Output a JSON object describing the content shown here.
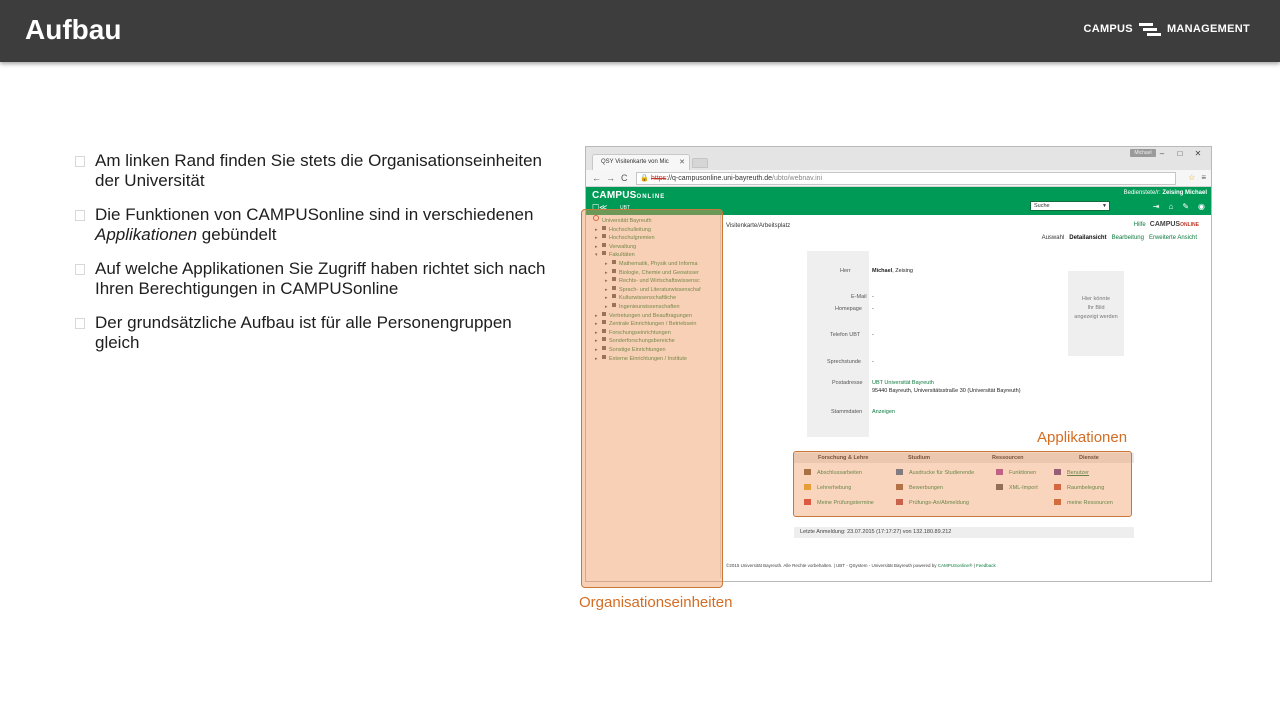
{
  "slide": {
    "title": "Aufbau",
    "brand": {
      "left": "CAMPUS",
      "right": "MANAGEMENT"
    }
  },
  "bullets": [
    {
      "text": "Am linken Rand finden Sie stets die Organisationseinheiten der Universität"
    },
    {
      "pre": "Die Funktionen von CAMPUSonline sind in verschiedenen ",
      "em": "Applikationen",
      "post": " gebündelt"
    },
    {
      "text": "Auf welche Applikationen Sie Zugriff haben richtet sich nach Ihren Berechtigungen in CAMPUSonline"
    },
    {
      "text": "Der grundsätzliche Aufbau ist für alle Personengruppen gleich"
    }
  ],
  "browser": {
    "tab_title": "QSY Visitenkarte von Mic",
    "tab_close": "✕",
    "window_user": "Michael",
    "window_buttons": [
      "–",
      "□",
      "✕"
    ],
    "nav": {
      "back": "←",
      "forward": "→",
      "reload": "C"
    },
    "url": {
      "lock": "🔒",
      "scheme": "https",
      "rest": "://q-campusonline.uni-bayreuth.de",
      "path": "/ubto/webnav.ini"
    },
    "addr_icons": {
      "star": "☆",
      "menu": "≡"
    }
  },
  "app": {
    "logo": "CAMPUS",
    "logo_online": "ONLINE",
    "sub_icons": "☐≪",
    "ubt": "UBT",
    "user_label": "Bedienstete/r: ",
    "user_name": "Zeising Michael",
    "search_placeholder": "Suche",
    "search_dd": "▼",
    "header_icons": [
      "⇥",
      "⌂",
      "✎",
      "◉"
    ]
  },
  "tree": [
    {
      "label": "Universität Bayreuth",
      "level": "root",
      "arrow": ""
    },
    {
      "label": "Hochschulleitung",
      "level": "l1",
      "arrow": "▸"
    },
    {
      "label": "Hochschulgremien",
      "level": "l1",
      "arrow": "▸"
    },
    {
      "label": "Verwaltung",
      "level": "l1",
      "arrow": "▸"
    },
    {
      "label": "Fakultäten",
      "level": "l1",
      "arrow": "▾"
    },
    {
      "label": "Mathematik, Physik und Informa",
      "level": "l2",
      "arrow": "▸"
    },
    {
      "label": "Biologie, Chemie und Geowisser",
      "level": "l2",
      "arrow": "▸"
    },
    {
      "label": "Rechts- und Wirtschaftswissensc",
      "level": "l2",
      "arrow": "▸"
    },
    {
      "label": "Sprach- und Literaturwissenschaf",
      "level": "l2",
      "arrow": "▸"
    },
    {
      "label": "Kulturwissenschaftliche",
      "level": "l2",
      "arrow": "▸"
    },
    {
      "label": "Ingenieurwissenschaften",
      "level": "l2",
      "arrow": "▸"
    },
    {
      "label": "Vertretungen und Beauftragungen",
      "level": "l1",
      "arrow": "▸"
    },
    {
      "label": "Zentrale Einrichtungen / Betriebsein",
      "level": "l1",
      "arrow": "▸"
    },
    {
      "label": "Forschungseinrichtungen",
      "level": "l1",
      "arrow": "▸"
    },
    {
      "label": "Sonderforschungsbereiche",
      "level": "l1",
      "arrow": "▸"
    },
    {
      "label": "Sonstige Einrichtungen",
      "level": "l1",
      "arrow": "▸"
    },
    {
      "label": "Externe Einrichtungen / Institute",
      "level": "l1",
      "arrow": "▸"
    }
  ],
  "content": {
    "breadcrumb": "Visitenkarte/Arbeitsplatz",
    "help": "Hilfe",
    "view_tabs": [
      "Auswahl",
      "Detailansicht",
      "Bearbeitung",
      "Erweiterte Ansicht"
    ],
    "profile": {
      "salutation_label": "Herr",
      "first_name": "Michael",
      "last_name": ", Zeising",
      "email_label": "E-Mail",
      "email_value": "-",
      "homepage_label": "Homepage",
      "homepage_value": "-",
      "phone_label": "Telefon  UBT",
      "phone_value": "-",
      "office_hours_label": "Sprechstunde",
      "office_hours_value": "-",
      "address_label": "Postadresse",
      "address_line1": "UBT Universität Bayreuth",
      "address_line2": "95440 Bayreuth, Universitätsstraße 30 (Universität Bayreuth)",
      "masterdata_label": "Stammdaten",
      "masterdata_value": "Anzeigen"
    },
    "photo_placeholder": [
      "Hier könnte",
      "Ihr Bild",
      "angezeigt werden"
    ],
    "apps": {
      "columns": [
        "Forschung & Lehre",
        "Studium",
        "Ressourcen",
        "Dienste"
      ],
      "col1": [
        "Abschlussarbeiten",
        "Lehrerhebung",
        "Meine Prüfungstermine"
      ],
      "col2": [
        "Ausdrucke für Studierende",
        "Bewerbungen",
        "Prüfungs-An/Abmeldung"
      ],
      "col3": [
        "Funktionen",
        "XML-Import"
      ],
      "col4": [
        "Benutzer",
        "Raumbelegung",
        "meine Ressourcen"
      ]
    },
    "last_login": "Letzte Anmeldung: 23.07.2015 (17:17:27) von 132.180.89.212",
    "footer_pre": "©2015 Universität Bayreuth. Alle Rechte vorbehalten. | UBT - QSystem - Universität Bayreuth powered by ",
    "footer_link": "CAMPUSonline®",
    "footer_sep": " | ",
    "footer_feedback": "Feedback"
  },
  "annotations": {
    "org_label": "Organisationseinheiten",
    "app_label": "Applikationen"
  },
  "colors": {
    "header_bg": "#3d3d3d",
    "campusonline_green": "#009a57",
    "highlight_fill": "#f0965a",
    "highlight_label": "#d36d24"
  }
}
